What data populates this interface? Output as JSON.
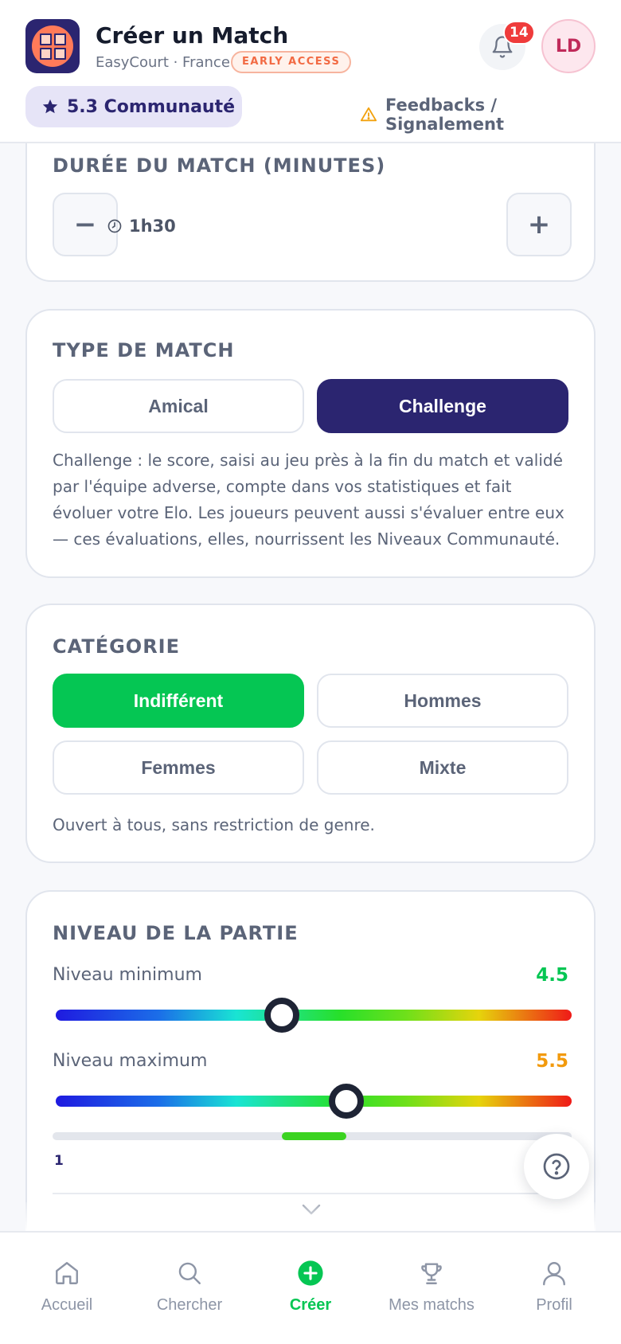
{
  "header": {
    "title": "Créer un Match",
    "subtitle": "EasyCourt · France",
    "badge": "EARLY ACCESS",
    "notifications_count": "14",
    "avatar_initials": "LD",
    "community_level": "5.3 Communauté",
    "feedback_link": "Feedbacks / Signalement"
  },
  "duration": {
    "title": "DURÉE DU MATCH (MINUTES)",
    "minus": "−",
    "plus": "+",
    "value": "1h30"
  },
  "match_type": {
    "title": "TYPE DE MATCH",
    "options": [
      "Amical",
      "Challenge"
    ],
    "selected": "Challenge",
    "description": "Challenge : le score, saisi au jeu près à la fin du match et validé par l'équipe adverse, compte dans vos statistiques et fait évoluer votre Elo. Les joueurs peuvent aussi s'évaluer entre eux — ces évaluations, elles, nourrissent les Niveaux Communauté."
  },
  "category": {
    "title": "CATÉGORIE",
    "options": [
      "Indifférent",
      "Hommes",
      "Femmes",
      "Mixte"
    ],
    "selected": "Indifférent",
    "description": "Ouvert à tous, sans restriction de genre."
  },
  "level": {
    "title": "NIVEAU DE LA PARTIE",
    "min_label": "Niveau minimum",
    "min_value": "4.5",
    "max_label": "Niveau maximum",
    "max_value": "5.5",
    "range_min_label": "1",
    "scale_min": 1,
    "scale_max": 9,
    "min_color": "#05c653",
    "max_color": "#f29a0d"
  },
  "bottom_nav": {
    "items": [
      "Accueil",
      "Chercher",
      "Créer",
      "Mes matchs",
      "Profil"
    ],
    "active": "Créer"
  },
  "colors": {
    "primary": "#2b2570",
    "accent_green": "#05c653",
    "alert_red": "#ef3b3b"
  }
}
